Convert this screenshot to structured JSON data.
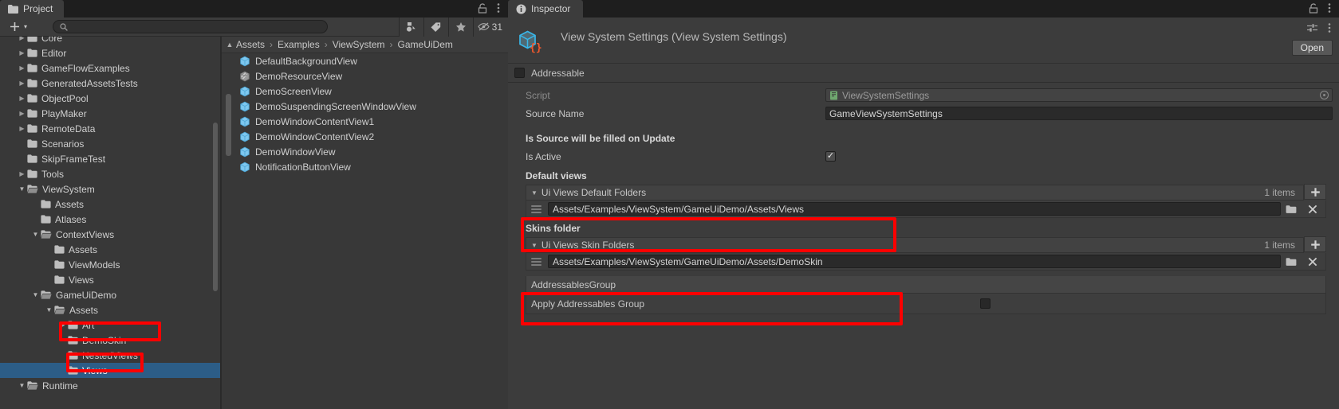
{
  "project_panel": {
    "tab_label": "Project",
    "tab_icon": "folder-icon",
    "lock_icon": "lock-icon",
    "menu_icon": "kebab-menu-icon",
    "toolbar": {
      "create_label": "+",
      "create_caret": "▾",
      "search_placeholder": "",
      "search_value": "",
      "search_icon": "search-icon",
      "filter_type_icon": "filter-by-type-icon",
      "filter_label_icon": "filter-by-label-icon",
      "favorites_icon": "star-icon",
      "hidden_packages_icon": "eye-off-icon",
      "hidden_count": "31"
    },
    "tree": [
      {
        "label": "Core",
        "indent": 1,
        "arrow": "collapsed",
        "open": false
      },
      {
        "label": "Editor",
        "indent": 1,
        "arrow": "collapsed",
        "open": false
      },
      {
        "label": "GameFlowExamples",
        "indent": 1,
        "arrow": "collapsed",
        "open": false
      },
      {
        "label": "GeneratedAssetsTests",
        "indent": 1,
        "arrow": "collapsed",
        "open": false
      },
      {
        "label": "ObjectPool",
        "indent": 1,
        "arrow": "collapsed",
        "open": false
      },
      {
        "label": "PlayMaker",
        "indent": 1,
        "arrow": "collapsed",
        "open": false
      },
      {
        "label": "RemoteData",
        "indent": 1,
        "arrow": "collapsed",
        "open": false
      },
      {
        "label": "Scenarios",
        "indent": 1,
        "arrow": "none",
        "open": false
      },
      {
        "label": "SkipFrameTest",
        "indent": 1,
        "arrow": "none",
        "open": false
      },
      {
        "label": "Tools",
        "indent": 1,
        "arrow": "collapsed",
        "open": false
      },
      {
        "label": "ViewSystem",
        "indent": 1,
        "arrow": "expanded",
        "open": true
      },
      {
        "label": "Assets",
        "indent": 2,
        "arrow": "none",
        "open": false
      },
      {
        "label": "Atlases",
        "indent": 2,
        "arrow": "none",
        "open": false
      },
      {
        "label": "ContextViews",
        "indent": 2,
        "arrow": "expanded",
        "open": true
      },
      {
        "label": "Assets",
        "indent": 3,
        "arrow": "none",
        "open": false
      },
      {
        "label": "ViewModels",
        "indent": 3,
        "arrow": "none",
        "open": false
      },
      {
        "label": "Views",
        "indent": 3,
        "arrow": "none",
        "open": false
      },
      {
        "label": "GameUiDemo",
        "indent": 2,
        "arrow": "expanded",
        "open": true
      },
      {
        "label": "Assets",
        "indent": 3,
        "arrow": "expanded",
        "open": true
      },
      {
        "label": "Art",
        "indent": 4,
        "arrow": "collapsed",
        "open": false
      },
      {
        "label": "DemoSkin",
        "indent": 4,
        "arrow": "none",
        "open": false
      },
      {
        "label": "NestedViews",
        "indent": 4,
        "arrow": "none",
        "open": false
      },
      {
        "label": "Views",
        "indent": 4,
        "arrow": "none",
        "open": false,
        "selected": true
      },
      {
        "label": "Runtime",
        "indent": 1,
        "arrow": "expanded",
        "open": true
      }
    ],
    "breadcrumb": [
      "Assets",
      "Examples",
      "ViewSystem",
      "GameUiDem"
    ],
    "breadcrumb_separator": "›",
    "files": [
      {
        "label": "DefaultBackgroundView",
        "icon": "prefab-icon"
      },
      {
        "label": "DemoResourceView",
        "icon": "prefab-variant-icon"
      },
      {
        "label": "DemoScreenView",
        "icon": "prefab-icon"
      },
      {
        "label": "DemoSuspendingScreenWindowView",
        "icon": "prefab-icon"
      },
      {
        "label": "DemoWindowContentView1",
        "icon": "prefab-icon"
      },
      {
        "label": "DemoWindowContentView2",
        "icon": "prefab-icon"
      },
      {
        "label": "DemoWindowView",
        "icon": "prefab-icon"
      },
      {
        "label": "NotificationButtonView",
        "icon": "prefab-icon"
      }
    ]
  },
  "inspector": {
    "tab_label": "Inspector",
    "tab_icon": "info-icon",
    "lock_icon": "lock-icon",
    "menu_icon": "kebab-menu-icon",
    "settings_icon": "preset-icon",
    "header_menu_icon": "kebab-menu-icon",
    "asset_icon": "scriptable-object-icon",
    "title": "View System Settings (View System Settings)",
    "open_button": "Open",
    "addressable_label": "Addressable",
    "addressable_checked": false,
    "fields": {
      "script_label": "Script",
      "script_value": "ViewSystemSettings",
      "script_icon": "script-icon",
      "source_name_label": "Source Name",
      "source_name_value": "GameViewSystemSettings",
      "is_source_filled_label": "Is Source will be filled on Update",
      "is_active_label": "Is Active",
      "is_active_checked": true
    },
    "default_views": {
      "section_title": "Default views",
      "list_header": "Ui Views Default Folders",
      "items_count": "1 items",
      "add_icon": "plus-icon",
      "caret_icon": "caret-down-icon",
      "rows": [
        {
          "path": "Assets/Examples/ViewSystem/GameUiDemo/Assets/Views",
          "grip_icon": "drag-handle-icon",
          "folder_icon": "folder-browse-icon",
          "remove_icon": "close-x-icon"
        }
      ]
    },
    "skins_folder": {
      "section_title": "Skins folder",
      "list_header": "Ui Views Skin Folders",
      "items_count": "1 items",
      "add_icon": "plus-icon",
      "caret_icon": "caret-down-icon",
      "rows": [
        {
          "path": "Assets/Examples/ViewSystem/GameUiDemo/Assets/DemoSkin",
          "grip_icon": "drag-handle-icon",
          "folder_icon": "folder-browse-icon",
          "remove_icon": "close-x-icon"
        }
      ]
    },
    "addressables": {
      "group_label": "AddressablesGroup",
      "apply_label": "Apply Addressables Group",
      "apply_checked": false
    }
  },
  "annotations": {
    "highlight_color": "#fe0000",
    "boxes": [
      "demoskin-tree-item",
      "views-tree-item",
      "default-views-path-row",
      "skins-folder-path-row"
    ]
  }
}
